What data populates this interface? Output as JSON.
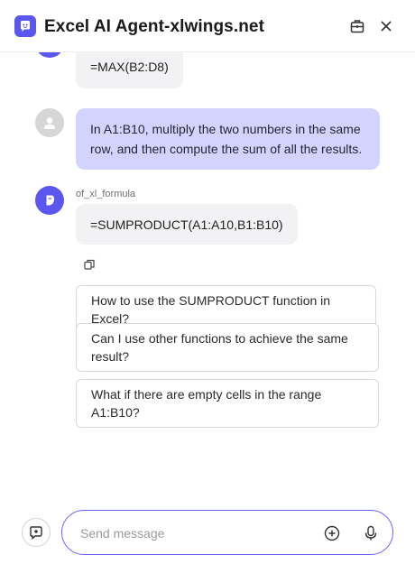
{
  "header": {
    "title": "Excel AI Agent-xlwings.net",
    "icons": [
      "app-logo-icon",
      "toolbox-icon",
      "close-icon"
    ]
  },
  "colors": {
    "accent": "#5b57ee",
    "user_bubble": "#d3d3ff",
    "bot_bubble": "#f2f2f4",
    "composer_border": "#6c63ff"
  },
  "messages": [
    {
      "role": "bot",
      "text": "=MAX(B2:D8)"
    },
    {
      "role": "user",
      "text": "In A1:B10, multiply the two numbers in the same row, and then compute the sum of all the results."
    },
    {
      "role": "bot",
      "name": "of_xl_formula",
      "text": "=SUMPRODUCT(A1:A10,B1:B10)"
    }
  ],
  "suggestions": [
    "How to use the SUMPRODUCT function in Excel?",
    "Can I use other functions to achieve the same result?",
    "What if there are empty cells in the range A1:B10?"
  ],
  "composer": {
    "placeholder": "Send message",
    "value": ""
  }
}
